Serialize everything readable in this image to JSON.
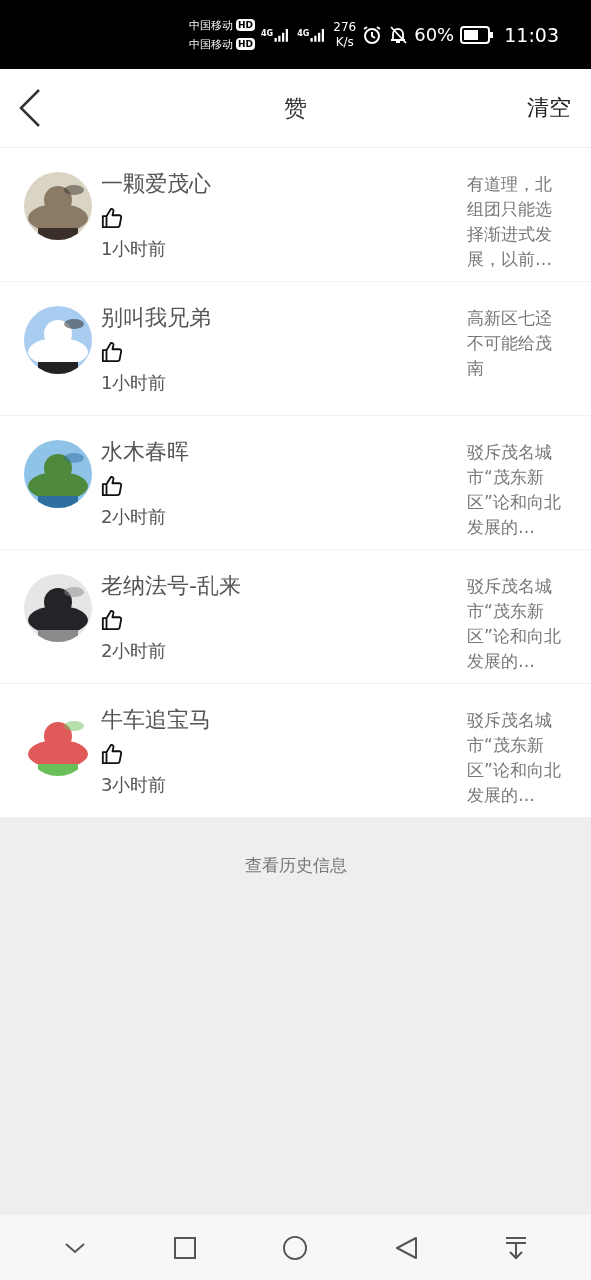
{
  "status_bar": {
    "carriers": [
      {
        "name": "中国移动",
        "badge": "HD"
      },
      {
        "name": "中国移动",
        "badge": "HD"
      }
    ],
    "network": [
      "4G",
      "4G"
    ],
    "speed_value": "276",
    "speed_unit": "K/s",
    "battery": "60%",
    "time": "11:03"
  },
  "header": {
    "title": "赞",
    "action": "清空"
  },
  "notifications": [
    {
      "name": "一颗爱茂心",
      "time": "1小时前",
      "excerpt": "有道理，北组团只能选择渐进式发展，以前…"
    },
    {
      "name": "别叫我兄弟",
      "time": "1小时前",
      "excerpt": "高新区七迳不可能给茂南"
    },
    {
      "name": "水木春晖",
      "time": "2小时前",
      "excerpt": "驳斥茂名城市“茂东新区”论和向北发展的…"
    },
    {
      "name": "老纳法号-乱来",
      "time": "2小时前",
      "excerpt": "驳斥茂名城市“茂东新区”论和向北发展的…"
    },
    {
      "name": "牛车追宝马",
      "time": "3小时前",
      "excerpt": "驳斥茂名城市“茂东新区”论和向北发展的…"
    }
  ],
  "footer": {
    "link": "查看历史信息"
  }
}
